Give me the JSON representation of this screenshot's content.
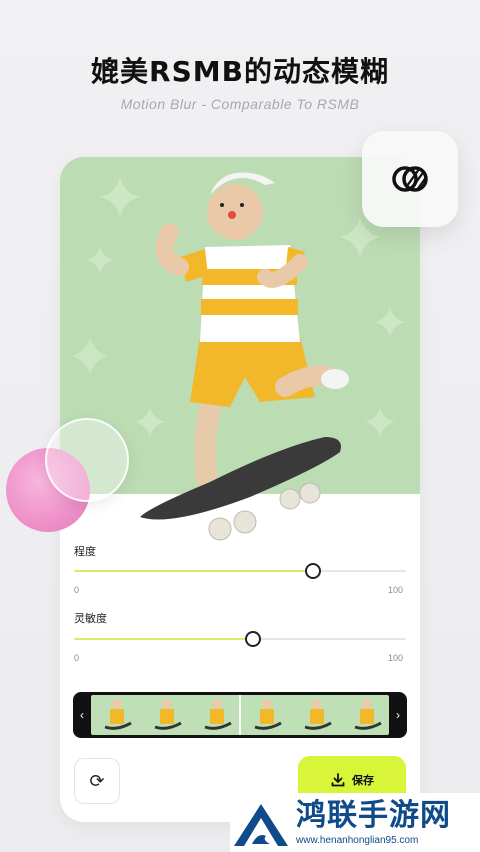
{
  "header": {
    "title": "媲美RSMB的动态模糊",
    "subtitle": "Motion Blur - Comparable To RSMB"
  },
  "float_button": {
    "icon": "overlap-circles-icon"
  },
  "sliders": [
    {
      "label": "程度",
      "min_label": "0",
      "max_label": "100",
      "value": 72
    },
    {
      "label": "灵敏度",
      "min_label": "0",
      "max_label": "100",
      "value": 54
    }
  ],
  "filmstrip": {
    "left_arrow": "‹",
    "right_arrow": "›",
    "frame_count": 6
  },
  "actions": {
    "refresh_icon": "⟳",
    "save_label": "保存",
    "save_icon": "download-icon"
  },
  "watermark": {
    "title": "鸿联手游网",
    "url": "www.henanhonglian95.com"
  },
  "colors": {
    "accent": "#d9f53a",
    "slider_fill": "#d6ee6f",
    "preview_bg": "#bcdcb4",
    "watermark_blue": "#0f4a8a"
  }
}
